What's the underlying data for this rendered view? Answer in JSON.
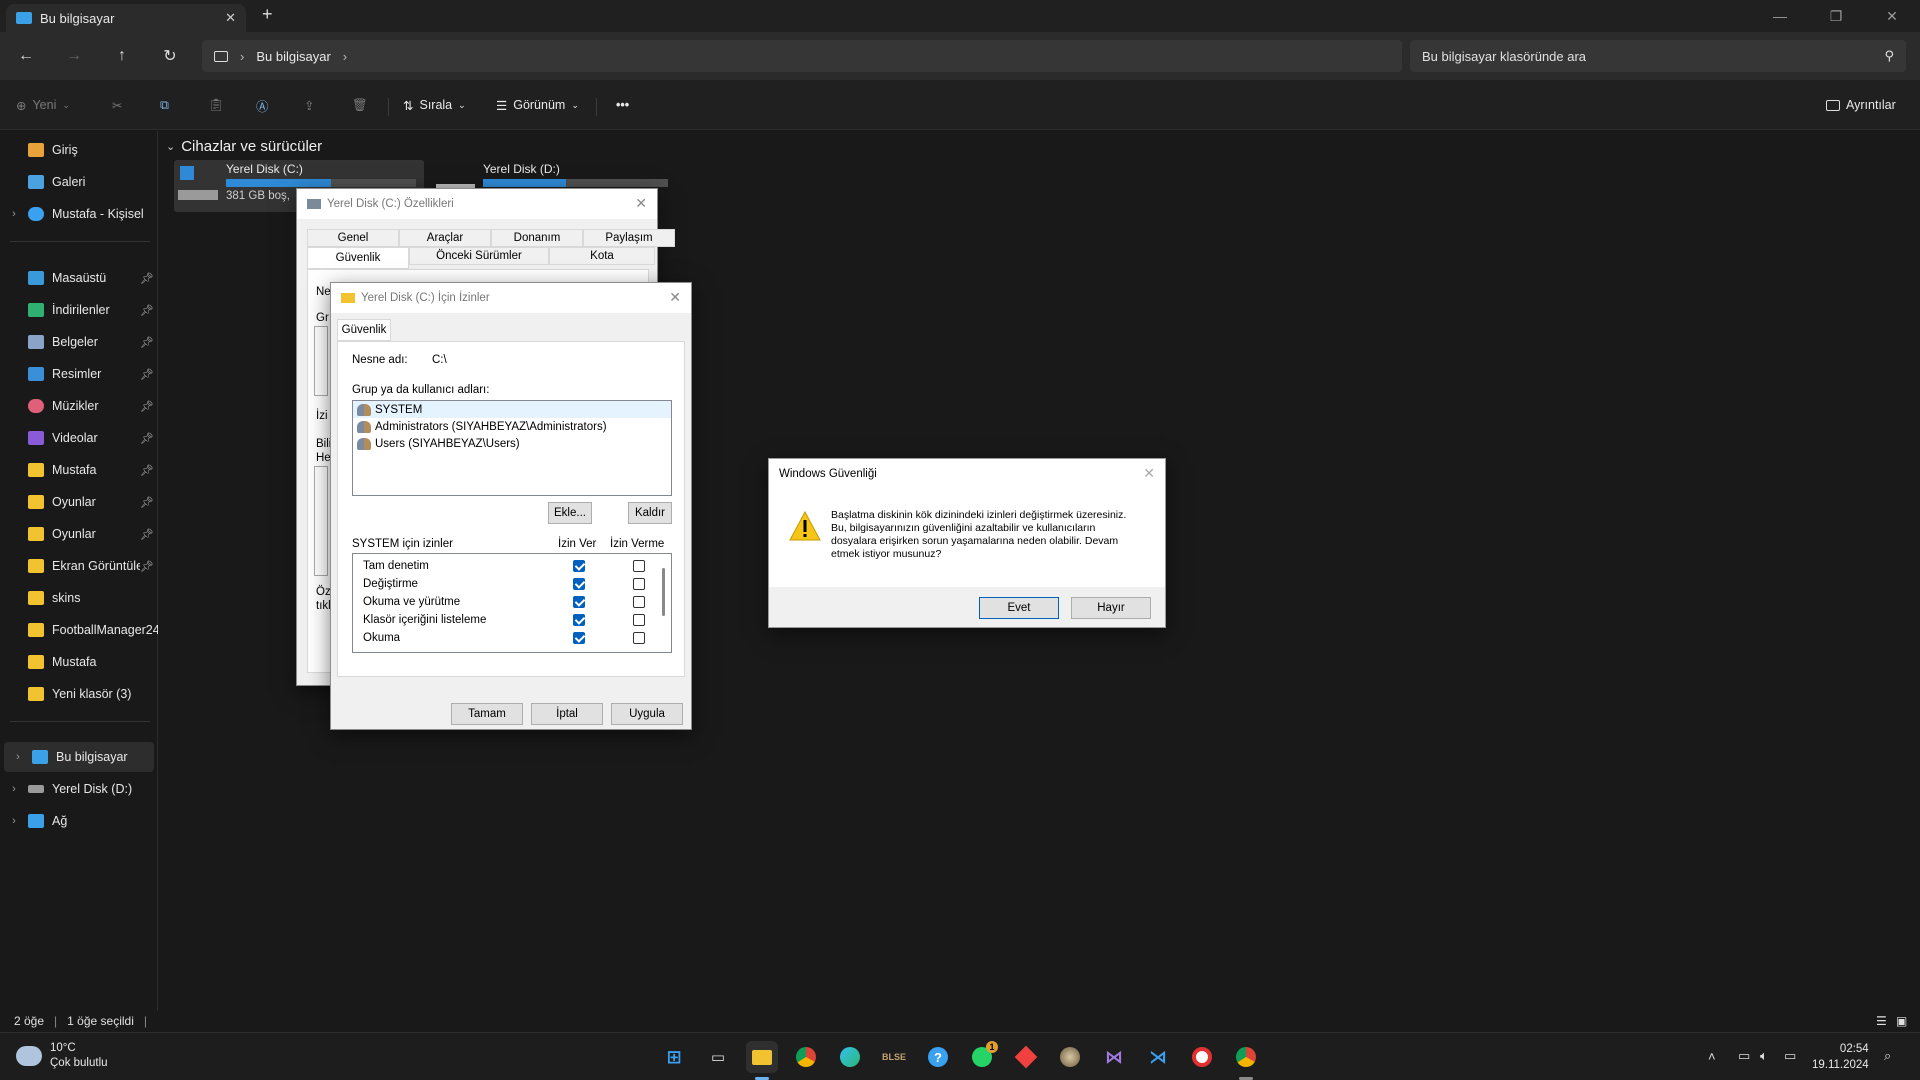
{
  "window": {
    "tab_title": "Bu bilgisayar",
    "new_tab": "+",
    "minimize": "—",
    "maximize": "❐",
    "close": "✕"
  },
  "nav": {
    "back_icon": "arrow-left-icon",
    "forward_icon": "arrow-right-icon",
    "up_icon": "arrow-up-icon",
    "refresh_icon": "refresh-icon",
    "breadcrumb": "Bu bilgisayar",
    "search_placeholder": "Bu bilgisayar klasöründe ara"
  },
  "toolbar": {
    "new_label": "Yeni",
    "sort_label": "Sırala",
    "view_label": "Görünüm",
    "more_label": "•••",
    "details_label": "Ayrıntılar"
  },
  "sidebar": {
    "top": [
      {
        "label": "Giriş",
        "icon": "home-icon"
      },
      {
        "label": "Galeri",
        "icon": "gallery-icon"
      },
      {
        "label": "Mustafa - Kişisel",
        "icon": "cloud-icon"
      }
    ],
    "pinned": [
      {
        "label": "Masaüstü",
        "icon": "desktop-icon"
      },
      {
        "label": "İndirilenler",
        "icon": "download-icon"
      },
      {
        "label": "Belgeler",
        "icon": "documents-icon"
      },
      {
        "label": "Resimler",
        "icon": "pictures-icon"
      },
      {
        "label": "Müzikler",
        "icon": "music-icon"
      },
      {
        "label": "Videolar",
        "icon": "videos-icon"
      },
      {
        "label": "Mustafa",
        "icon": "folder-icon"
      },
      {
        "label": "Oyunlar",
        "icon": "folder-icon"
      },
      {
        "label": "Oyunlar",
        "icon": "folder-icon"
      },
      {
        "label": "Ekran Görüntüleri",
        "icon": "folder-icon"
      },
      {
        "label": "skins",
        "icon": "folder-icon"
      },
      {
        "label": "FootballManager24",
        "icon": "folder-icon"
      },
      {
        "label": "Mustafa",
        "icon": "folder-icon"
      },
      {
        "label": "Yeni klasör (3)",
        "icon": "folder-icon"
      }
    ],
    "bottom": [
      {
        "label": "Bu bilgisayar",
        "icon": "computer-icon"
      },
      {
        "label": "Yerel Disk (D:)",
        "icon": "drive-icon"
      },
      {
        "label": "Ağ",
        "icon": "network-icon"
      }
    ]
  },
  "content": {
    "section_title": "Cihazlar ve sürücüler",
    "drives": [
      {
        "name": "Yerel Disk (C:)",
        "free": "381 GB boş,",
        "used_fraction": 0.55
      },
      {
        "name": "Yerel Disk (D:)",
        "free": "",
        "used_fraction": 0.45
      }
    ]
  },
  "status": {
    "items": "2 öğe",
    "selected": "1 öğe seçildi"
  },
  "props_dialog": {
    "title": "Yerel Disk (C:) Özellikleri",
    "tabs_row1": [
      "Genel",
      "Araçlar",
      "Donanım",
      "Paylaşım"
    ],
    "tabs_row2": [
      "Güvenlik",
      "Önceki Sürümler",
      "Kota"
    ],
    "frag_object": "Nesne adı:",
    "frag_object_val": "C:\\",
    "frag_group": "Gr",
    "frag_perm": "İzi",
    "frag_bili": "Bili",
    "frag_he": "He",
    "frag_oz": "Öz",
    "frag_tik": "tıkl"
  },
  "perm_dialog": {
    "title": "Yerel Disk (C:) İçin İzinler",
    "tab": "Güvenlik",
    "object_label": "Nesne adı:",
    "object_value": "C:\\",
    "group_label": "Grup ya da kullanıcı adları:",
    "users": [
      "SYSTEM",
      "Administrators (SIYAHBEYAZ\\Administrators)",
      "Users (SIYAHBEYAZ\\Users)"
    ],
    "add_button": "Ekle...",
    "remove_button": "Kaldır",
    "perms_label": "SYSTEM için izinler",
    "allow_header": "İzin Ver",
    "deny_header": "İzin Verme",
    "perms": [
      {
        "name": "Tam denetim",
        "allow": true,
        "deny": false
      },
      {
        "name": "Değiştirme",
        "allow": true,
        "deny": false
      },
      {
        "name": "Okuma ve yürütme",
        "allow": true,
        "deny": false
      },
      {
        "name": "Klasör içeriğini listeleme",
        "allow": true,
        "deny": false
      },
      {
        "name": "Okuma",
        "allow": true,
        "deny": false
      }
    ],
    "ok_button": "Tamam",
    "cancel_button": "İptal",
    "apply_button": "Uygula"
  },
  "security_dialog": {
    "title": "Windows Güvenliği",
    "message": "Başlatma diskinin kök dizinindeki izinleri değiştirmek üzeresiniz. Bu, bilgisayarınızın güvenliğini azaltabilir ve kullanıcıların dosyalara erişirken sorun yaşamalarına neden olabilir. Devam etmek istiyor musunuz?",
    "yes_button": "Evet",
    "no_button": "Hayır"
  },
  "taskbar": {
    "weather_temp": "10°C",
    "weather_desc": "Çok bulutlu",
    "time": "02:54",
    "date": "19.11.2024",
    "whatsapp_badge": "1"
  }
}
